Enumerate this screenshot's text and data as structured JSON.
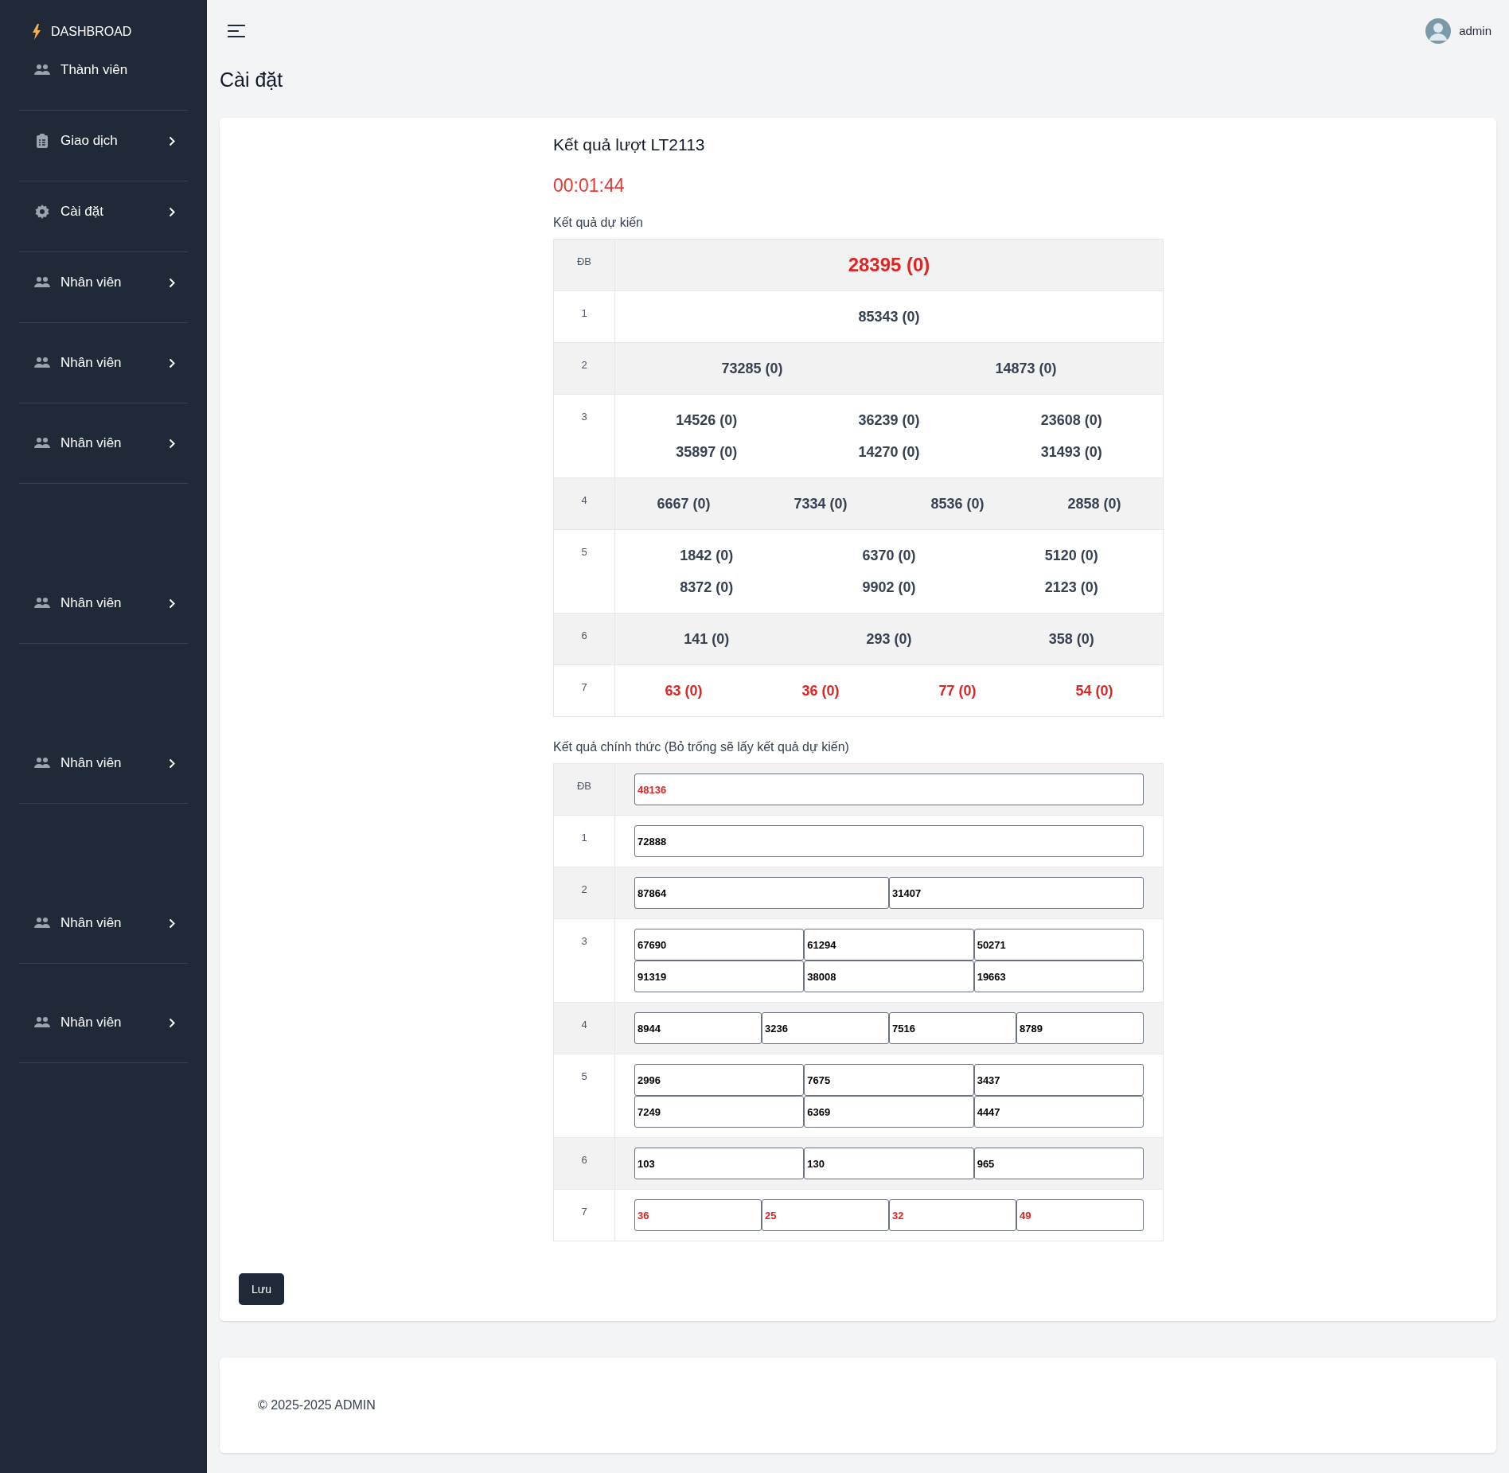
{
  "sidebar": {
    "brand": "DASHBROAD",
    "items": [
      {
        "label": "Thành viên",
        "kind": "users",
        "has_submenu": false
      },
      {
        "label": "Giao dịch",
        "kind": "clipboard",
        "has_submenu": true
      },
      {
        "label": "Cài đặt",
        "kind": "gear",
        "has_submenu": true
      },
      {
        "label": "Nhân viên",
        "kind": "users",
        "has_submenu": true
      },
      {
        "label": "Nhân viên",
        "kind": "users",
        "has_submenu": true
      },
      {
        "label": "Nhân viên",
        "kind": "users",
        "has_submenu": true
      },
      {
        "label": "Nhân viên",
        "kind": "users",
        "has_submenu": true
      },
      {
        "label": "Nhân viên",
        "kind": "users",
        "has_submenu": true
      },
      {
        "label": "Nhân viên",
        "kind": "users",
        "has_submenu": true
      },
      {
        "label": "Nhân viên",
        "kind": "users",
        "has_submenu": true
      }
    ]
  },
  "header": {
    "user": "admin"
  },
  "page_title": "Cài đặt",
  "round_title": "Kết quả lượt LT2113",
  "countdown": "00:01:44",
  "expected": {
    "label": "Kết quả dự kiến",
    "rows": [
      {
        "prize": "ĐB",
        "highlight": true,
        "kind": "special",
        "lines": [
          [
            "28395 (0)"
          ]
        ]
      },
      {
        "prize": "1",
        "highlight": false,
        "kind": "normal",
        "lines": [
          [
            "85343 (0)"
          ]
        ]
      },
      {
        "prize": "2",
        "highlight": false,
        "kind": "normal",
        "lines": [
          [
            "73285 (0)",
            "14873 (0)"
          ]
        ]
      },
      {
        "prize": "3",
        "highlight": false,
        "kind": "normal",
        "lines": [
          [
            "14526 (0)",
            "36239 (0)",
            "23608 (0)"
          ],
          [
            "35897 (0)",
            "14270 (0)",
            "31493 (0)"
          ]
        ]
      },
      {
        "prize": "4",
        "highlight": false,
        "kind": "normal",
        "lines": [
          [
            "6667 (0)",
            "7334 (0)",
            "8536 (0)",
            "2858 (0)"
          ]
        ]
      },
      {
        "prize": "5",
        "highlight": false,
        "kind": "normal",
        "lines": [
          [
            "1842 (0)",
            "6370 (0)",
            "5120 (0)"
          ],
          [
            "8372 (0)",
            "9902 (0)",
            "2123 (0)"
          ]
        ]
      },
      {
        "prize": "6",
        "highlight": false,
        "kind": "normal",
        "lines": [
          [
            "141 (0)",
            "293 (0)",
            "358 (0)"
          ]
        ]
      },
      {
        "prize": "7",
        "highlight": true,
        "kind": "normal",
        "lines": [
          [
            "63 (0)",
            "36 (0)",
            "77 (0)",
            "54 (0)"
          ]
        ]
      }
    ]
  },
  "official": {
    "label": "Kết quả chính thức (Bỏ trống sẽ lấy kết quả dự kiến)",
    "rows": [
      {
        "prize": "ĐB",
        "highlight": true,
        "lines": [
          [
            "48136"
          ]
        ]
      },
      {
        "prize": "1",
        "highlight": false,
        "lines": [
          [
            "72888"
          ]
        ]
      },
      {
        "prize": "2",
        "highlight": false,
        "lines": [
          [
            "87864",
            "31407"
          ]
        ]
      },
      {
        "prize": "3",
        "highlight": false,
        "lines": [
          [
            "67690",
            "61294",
            "50271"
          ],
          [
            "91319",
            "38008",
            "19663"
          ]
        ]
      },
      {
        "prize": "4",
        "highlight": false,
        "lines": [
          [
            "8944",
            "3236",
            "7516",
            "8789"
          ]
        ]
      },
      {
        "prize": "5",
        "highlight": false,
        "lines": [
          [
            "2996",
            "7675",
            "3437"
          ],
          [
            "7249",
            "6369",
            "4447"
          ]
        ]
      },
      {
        "prize": "6",
        "highlight": false,
        "lines": [
          [
            "103",
            "130",
            "965"
          ]
        ]
      },
      {
        "prize": "7",
        "highlight": true,
        "lines": [
          [
            "36",
            "25",
            "32",
            "49"
          ]
        ]
      }
    ]
  },
  "save_button": "Lưu",
  "footer": "© 2025-2025 ADMIN"
}
